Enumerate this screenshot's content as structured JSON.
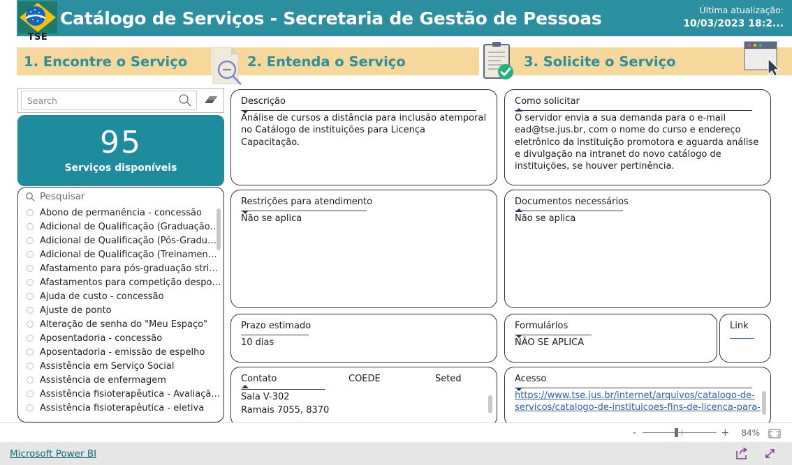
{
  "header": {
    "title": "Catálogo de Serviços - Secretaria de Gestão de Pessoas",
    "update_label": "Última atualização:",
    "update_value": "10/03/2023 18:2...",
    "logo_text": "TSE"
  },
  "steps": [
    {
      "label": "1. Encontre o Serviço",
      "icon": "search-document-icon"
    },
    {
      "label": "2. Entenda o Serviço",
      "icon": "clipboard-check-icon"
    },
    {
      "label": "3. Solicite o Serviço",
      "icon": "browser-window-icon"
    }
  ],
  "sidebar": {
    "search_placeholder": "Search",
    "search_value": "",
    "clear_icon": "eraser-icon",
    "search_icon": "search-icon",
    "kpi": {
      "value": "95",
      "label": "Serviços disponíveis"
    },
    "list_search_placeholder": "Pesquisar",
    "services": [
      "Abono de permanência - concessão",
      "Adicional de Qualificação (Graduação…",
      "Adicional de Qualificação (Pós-Gradu…",
      "Adicional de Qualificação (Treinamen…",
      "Afastamento para pós-graduação stri…",
      "Afastamentos para competição despo…",
      "Ajuda de custo - concessão",
      "Ajuste de ponto",
      "Alteração de senha do \"Meu Espaço\"",
      "Aposentadoria - concessão",
      "Aposentadoria - emissão de espelho",
      "Assistência em Serviço Social",
      "Assistência de enfermagem",
      "Assistência fisioterapêutica - Avaliaçã…",
      "Assistência fisioterapêutica - eletiva"
    ]
  },
  "panels": {
    "descricao": {
      "title": "Descrição",
      "body": "Análise de cursos a distância para inclusão atemporal no Catálogo de instituições para Licença Capacitação."
    },
    "restricoes": {
      "title": "Restrições para atendimento",
      "body": "Não se aplica"
    },
    "prazo": {
      "title": "Prazo estimado",
      "body": "10 dias"
    },
    "contato": {
      "title": "Contato",
      "col1": "COEDE",
      "col2": "Seted",
      "line1": "Sala V-302",
      "line2": "Ramais 7055, 8370"
    },
    "como_solicitar": {
      "title": "Como solicitar",
      "body": "O servidor envia a sua demanda para o e-mail ead@tse.jus.br, com o nome do curso e endereço eletrônico da instituição promotora e aguarda análise e divulgação na intranet do novo catálogo de instituições, se houver pertinência."
    },
    "documentos": {
      "title": "Documentos necessários",
      "body": "Não se aplica"
    },
    "formularios": {
      "title": "Formulários",
      "body": "NÃO SE APLICA"
    },
    "link": {
      "title": "Link"
    },
    "acesso": {
      "title": "Acesso",
      "body": "https://www.tse.jus.br/internet/arquivos/catalogo-de-servicos/catalogo-de-instituicoes-fins-de-licenca-para-"
    }
  },
  "footer": {
    "zoom_minus": "-",
    "zoom_plus": "+",
    "zoom_percent": "84%",
    "fit_icon": "fit-to-page-icon",
    "powerbi_label": "Microsoft Power BI",
    "share_icon": "share-icon",
    "fullscreen_icon": "fullscreen-icon"
  },
  "colors": {
    "header_teal": "#2C8FA0",
    "step_yellow": "#F6D79C",
    "step_text_teal": "#2C8FA0",
    "kpi_teal": "#1F8C9E",
    "link_blue": "#2C5EB8",
    "powerbi_teal": "#096B78"
  }
}
